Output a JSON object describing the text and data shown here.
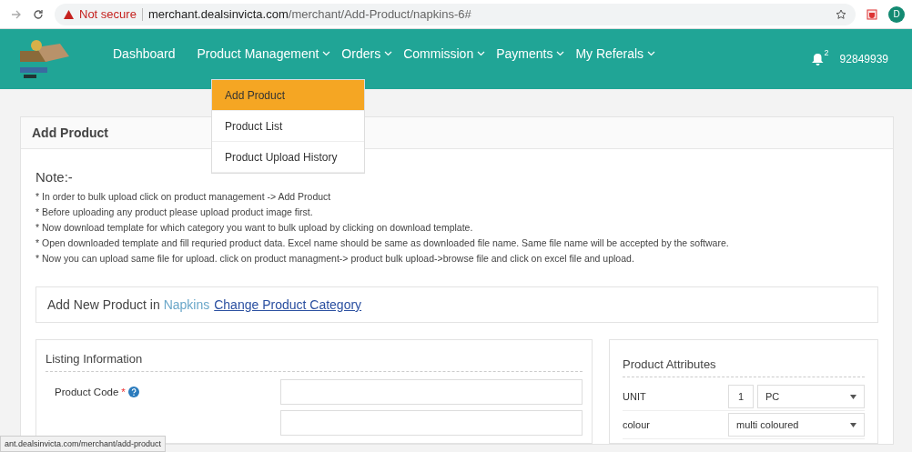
{
  "browser": {
    "security": "Not secure",
    "host": "merchant.dealsinvicta.com",
    "path": "/merchant/Add-Product/napkins-6#",
    "profile_initial": "D"
  },
  "nav": {
    "items": [
      {
        "label": "Dashboard",
        "dropdown": false
      },
      {
        "label": "Product Management",
        "dropdown": true
      },
      {
        "label": "Orders",
        "dropdown": true
      },
      {
        "label": "Commission",
        "dropdown": true
      },
      {
        "label": "Payments",
        "dropdown": true
      },
      {
        "label": "My Referals",
        "dropdown": true
      }
    ],
    "notification_count": "2",
    "user": "92849939"
  },
  "dropdown": {
    "items": [
      {
        "label": "Add Product",
        "selected": true
      },
      {
        "label": "Product List",
        "selected": false
      },
      {
        "label": "Product Upload History",
        "selected": false
      }
    ]
  },
  "card": {
    "title": "Add Product",
    "note_heading": "Note:-",
    "notes": [
      "* In order to bulk upload click on product management -> Add Product",
      "* Before uploading any product please upload product image first.",
      "* Now download template for which category you want to bulk upload by clicking on download template.",
      "* Open downloaded template and fill requried product data. Excel name should be same as downloaded file name. Same file name will be accepted by the software.",
      "* Now you can upload same file for upload. click on product managment-> product bulk upload->browse file and click on excel file and upload."
    ]
  },
  "category": {
    "prefix": "Add New Product in",
    "name": "Napkins",
    "link": "Change Product Category"
  },
  "listing": {
    "title": "Listing Information",
    "fields": [
      {
        "kind": "labeled",
        "label": "Product Code",
        "required_mark": "*",
        "help": true
      },
      {
        "kind": "input_only"
      }
    ]
  },
  "attributes": {
    "title": "Product Attributes",
    "rows": [
      {
        "kind": "unit",
        "label": "UNIT",
        "qty": "1",
        "value": "PC"
      },
      {
        "kind": "select",
        "label": "colour",
        "value": "multi coloured"
      }
    ]
  },
  "status_url": "ant.dealsinvicta.com/merchant/add-product"
}
